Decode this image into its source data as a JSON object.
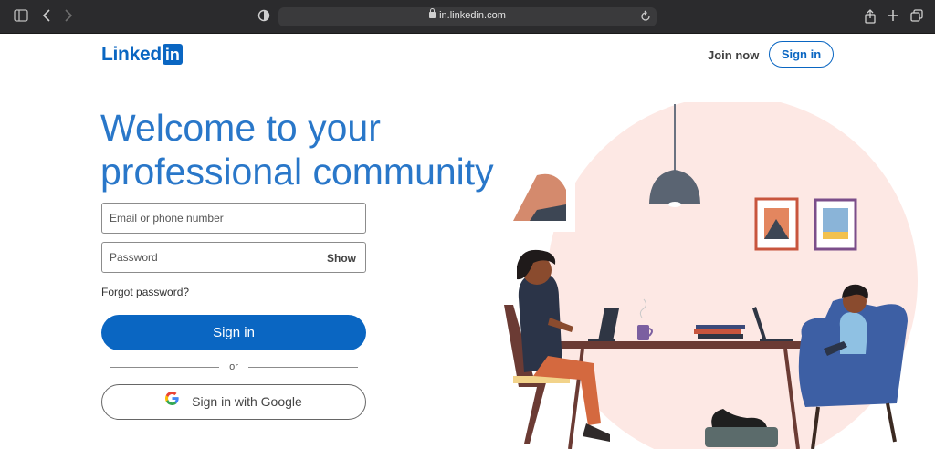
{
  "browser": {
    "url": "in.linkedin.com",
    "icons": [
      "sidebar-icon",
      "back-icon",
      "forward-icon",
      "privacy-shield-icon",
      "reload-icon",
      "share-icon",
      "new-tab-icon",
      "tabs-overview-icon"
    ]
  },
  "header": {
    "logo_text": "Linked",
    "logo_box": "in",
    "join_label": "Join now",
    "signin_label": "Sign in"
  },
  "hero": {
    "headline": "Welcome to your professional community"
  },
  "form": {
    "email_placeholder": "Email or phone number",
    "password_placeholder": "Password",
    "show_label": "Show",
    "forgot_label": "Forgot password?",
    "signin_button": "Sign in",
    "or_label": "or",
    "google_button": "Sign in with Google"
  },
  "colors": {
    "brand": "#0a66c2",
    "headline": "#2977c9",
    "illustration_bg": "#fde8e4"
  }
}
